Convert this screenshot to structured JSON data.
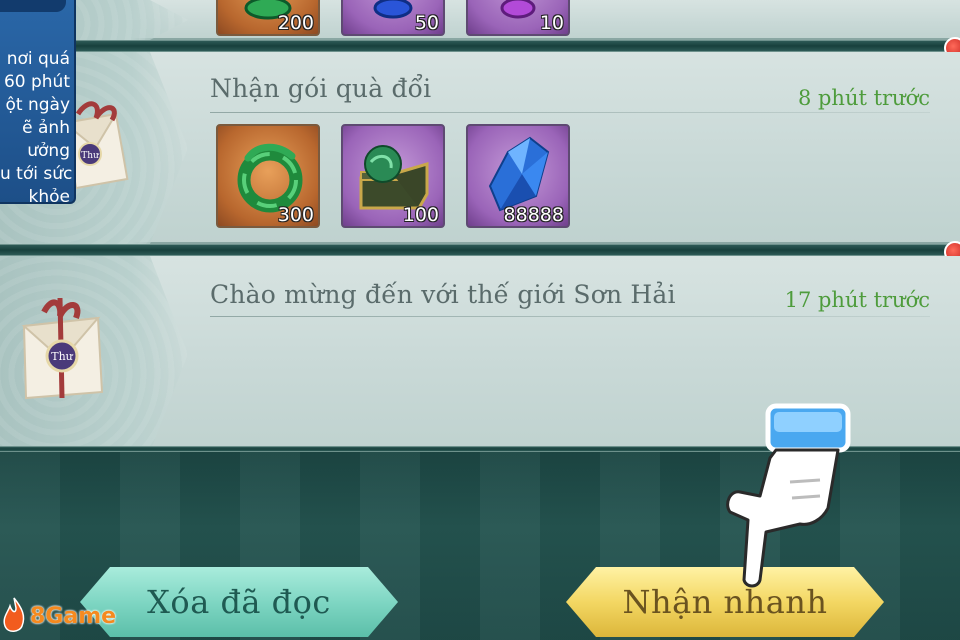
{
  "notice": {
    "lines": [
      "nơi quá",
      "60 phút",
      "ột ngày",
      "ẽ ảnh",
      "ưởng",
      "u tới sức",
      "khỏe"
    ]
  },
  "mails": [
    {
      "subject": "",
      "time": "",
      "items": [
        {
          "icon": "green-gem-icon",
          "count": "200"
        },
        {
          "icon": "blue-gem-icon",
          "count": "50"
        },
        {
          "icon": "purple-gem-icon",
          "count": "10"
        }
      ]
    },
    {
      "subject": "Nhận gói quà đổi",
      "time": "8 phút trước",
      "envelope_label": "Thư",
      "items": [
        {
          "icon": "jade-ring-icon",
          "count": "300"
        },
        {
          "icon": "treasure-chest-icon",
          "count": "100"
        },
        {
          "icon": "blue-crystal-icon",
          "count": "88888"
        }
      ]
    },
    {
      "subject": "Chào mừng đến với thế giới Sơn Hải",
      "time": "17 phút trước",
      "envelope_label": "Thư",
      "items": []
    }
  ],
  "buttons": {
    "delete_read": "Xóa đã đọc",
    "quick_receive": "Nhận nhanh"
  },
  "logo": {
    "text": "8Game"
  },
  "colors": {
    "time_green": "#4e9c3c",
    "teal_button": "#7fd6c3",
    "gold_button": "#f3d763",
    "notification_red": "#c21f1a"
  }
}
